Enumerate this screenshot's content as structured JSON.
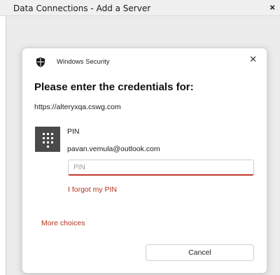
{
  "outer_window": {
    "title": "Data Connections - Add a Server",
    "close_label": "×"
  },
  "dialog": {
    "app_name": "Windows Security",
    "close_label": "✕",
    "heading": "Please enter the credentials for:",
    "url": "https://alteryxqa.cswg.com",
    "credential": {
      "icon": "pin-keypad-icon",
      "label": "PIN",
      "account": "pavan.vemula@outlook.com"
    },
    "pin_input": {
      "value": "",
      "placeholder": "PIN"
    },
    "forgot_pin_link": "I forgot my PIN",
    "more_choices_link": "More choices",
    "cancel_button": "Cancel"
  },
  "colors": {
    "accent": "#b5321f",
    "tile": "#4a4a4a"
  }
}
